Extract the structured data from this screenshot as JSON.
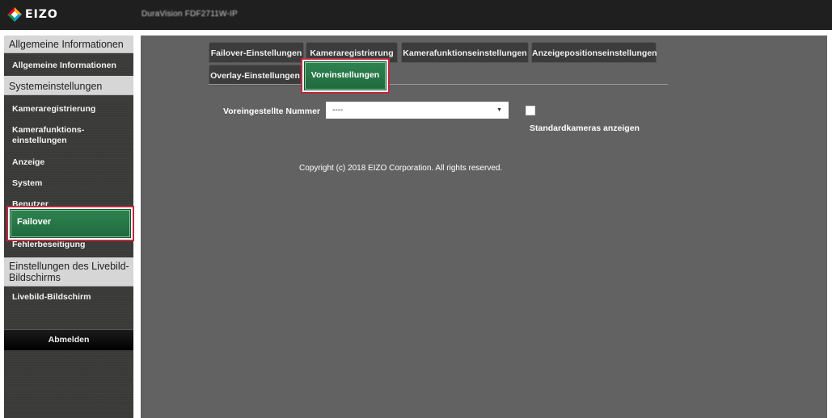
{
  "header": {
    "logo_text": "EIZO",
    "device_name": "DuraVision FDF2711W-IP"
  },
  "sidebar": {
    "sections": [
      {
        "title": "Allgemeine Informationen",
        "items": [
          "Allgemeine Informationen"
        ]
      },
      {
        "title": "Systemeinstellungen",
        "items": [
          "Kameraregistrierung",
          "Kamerafunktions-",
          "einstellungen",
          "Anzeige",
          "System",
          "Benutzer",
          "Failover",
          "Fehlerbeseitigung"
        ]
      },
      {
        "title": "Einstellungen des Livebild-",
        "title2": "Bildschirms",
        "items": [
          "Livebild-Bildschirm"
        ]
      }
    ],
    "logout_label": "Abmelden"
  },
  "tabs": {
    "row1": [
      "Failover-Einstellungen",
      "Kameraregistrierung",
      "Kamerafunktionseinstellungen",
      "Anzeigepositionseinstellungen"
    ],
    "row2": [
      "Overlay-Einstellungen",
      "Voreinstellungen"
    ],
    "active": "Voreinstellungen"
  },
  "form": {
    "preset_label": "Voreingestellte Nummer",
    "preset_value": "----",
    "show_default_label": "Standardkameras anzeigen",
    "show_default_checked": false
  },
  "footer": {
    "copyright": "Copyright (c) 2018 EIZO Corporation. All rights reserved."
  },
  "colors": {
    "active_green": "#2a7a49",
    "highlight_red": "#c0293e",
    "content_bg": "#626262",
    "sidebar_bg": "#3a3a38"
  }
}
